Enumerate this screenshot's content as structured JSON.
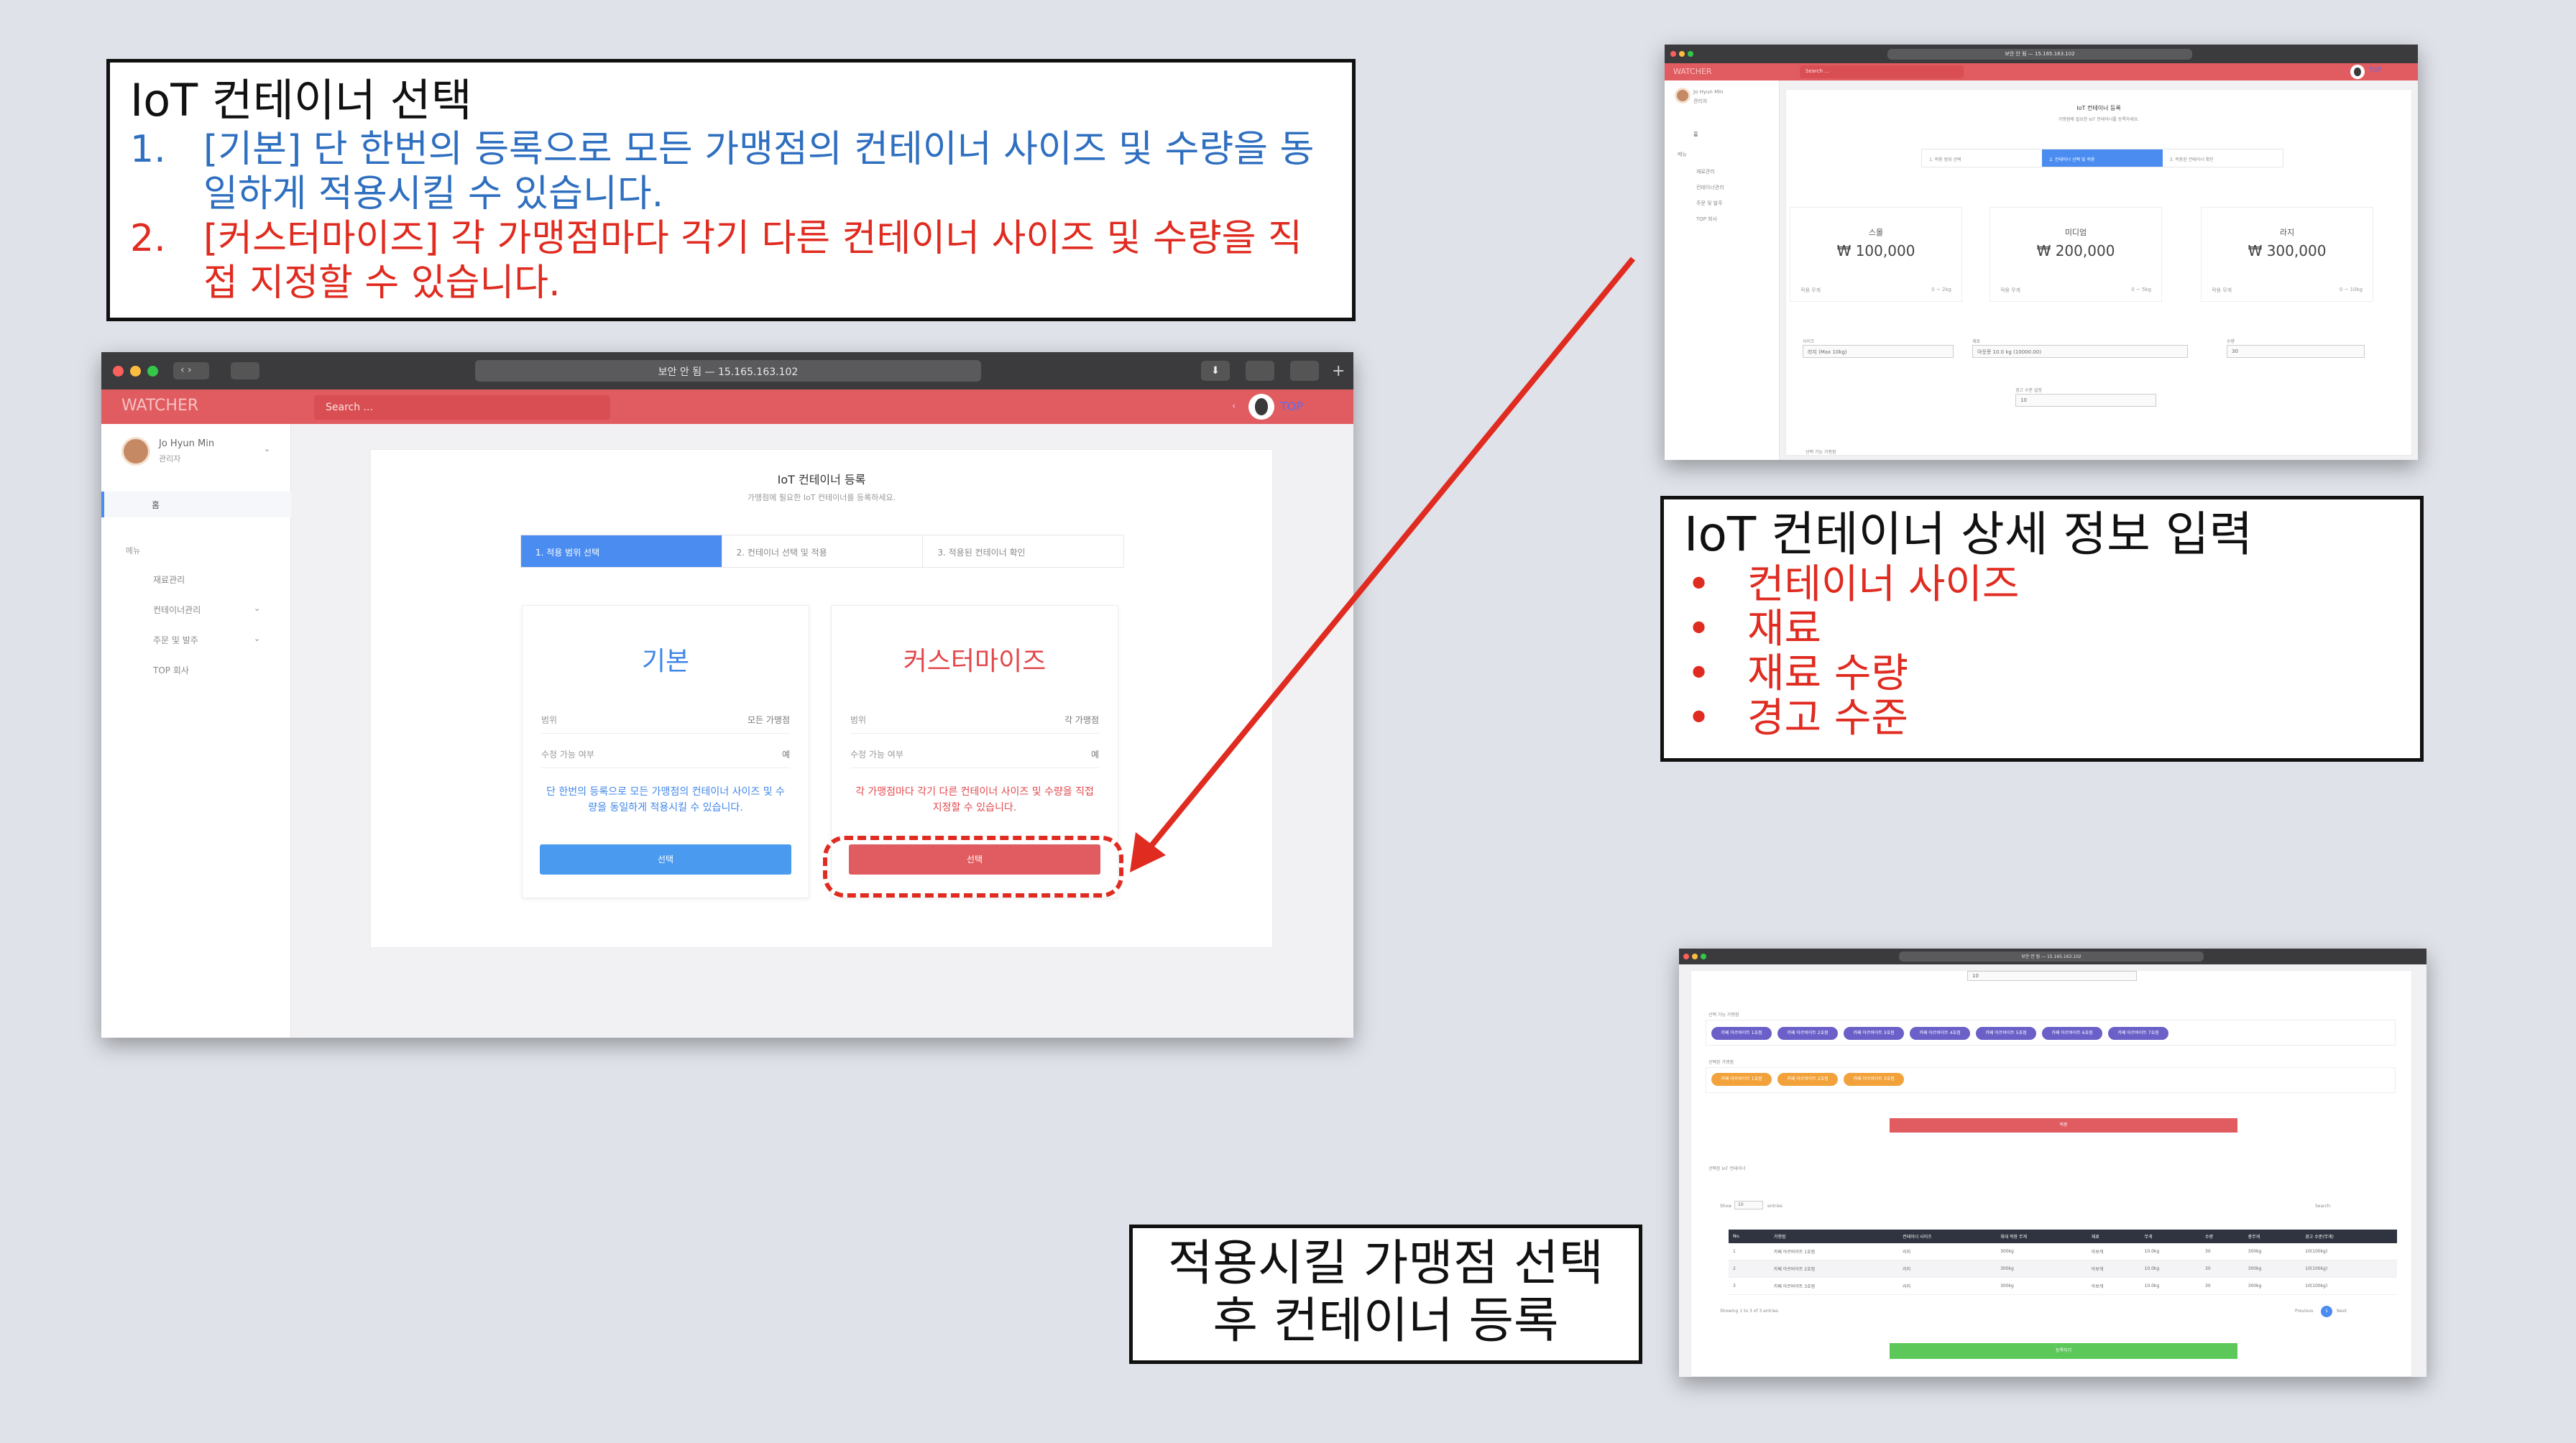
{
  "callout_select": {
    "title": "IoT 컨테이너 선택",
    "items": [
      {
        "num": "1.",
        "text": "[기본] 단 한번의 등록으로 모든 가맹점의 컨테이너 사이즈 및 수량을 동일하게 적용시킬 수 있습니다."
      },
      {
        "num": "2.",
        "text": "[커스터마이즈] 각 가맹점마다 각기 다른 컨테이너 사이즈 및 수량을 직접 지정할 수 있습니다."
      }
    ]
  },
  "callout_detail": {
    "title": "IoT 컨테이너 상세 정보 입력",
    "bullet": "•",
    "items": [
      "컨테이너 사이즈",
      "재료",
      "재료 수량",
      "경고 수준"
    ]
  },
  "callout_apply": {
    "line1": "적용시킬 가맹점 선택",
    "line2": "후 컨테이너 등록"
  },
  "main_window": {
    "url": "보안 안 됨 — 15.165.163.102",
    "brand": "WATCHER",
    "search_placeholder": "Search ...",
    "top_user": "TOP",
    "user_name": "Jo Hyun Min",
    "user_role": "관리자",
    "sidebar": {
      "home": "홈",
      "menu_label": "메뉴",
      "items": [
        "재료관리",
        "컨테이너관리",
        "주문 및 발주",
        "TOP 회사"
      ]
    },
    "page_title": "IoT 컨테이너 등록",
    "page_subtitle": "가맹점에 필요한 IoT 컨테이너를 등록하세요.",
    "steps": [
      "1. 적용 범위 선택",
      "2. 컨테이너 선택 및 적용",
      "3. 적용된 컨테이너 확인"
    ],
    "cards": {
      "basic": {
        "name": "기본",
        "scope_label": "범위",
        "scope_value": "모든 가맹점",
        "editable_label": "수정 가능 여부",
        "editable_value": "예",
        "desc": "단 한번의 등록으로 모든 가맹점의 컨테이너 사이즈 및 수량을 동일하게 적용시킬 수 있습니다.",
        "button": "선택"
      },
      "custom": {
        "name": "커스터마이즈",
        "scope_label": "범위",
        "scope_value": "각 가맹점",
        "editable_label": "수정 가능 여부",
        "editable_value": "예",
        "desc": "각 가맹점마다 각기 다른 컨테이너 사이즈 및 수량을 직접 지정할 수 있습니다.",
        "button": "선택"
      }
    }
  },
  "detail_window": {
    "url": "보안 안 됨 — 15.165.163.102",
    "brand": "WATCHER",
    "search_placeholder": "Search ...",
    "top_user": "TOP",
    "user_name": "Jo Hyun Min",
    "user_role": "관리자",
    "sidebar": {
      "home": "홈",
      "menu_label": "메뉴",
      "items": [
        "재료관리",
        "컨테이너관리",
        "주문 및 발주",
        "TOP 회사"
      ]
    },
    "page_title": "IoT 컨테이너 등록",
    "page_subtitle": "가맹점에 필요한 IoT 컨테이너를 등록하세요.",
    "steps": [
      "1. 적용 범위 선택",
      "2. 컨테이너 선택 및 적용",
      "3. 적용된 컨테이너 확인"
    ],
    "sizes": [
      {
        "name": "스몰",
        "price": "₩ 100,000",
        "left": "적용 무게",
        "right": "0 ~ 2kg"
      },
      {
        "name": "미디엄",
        "price": "₩ 200,000",
        "left": "적용 무게",
        "right": "0 ~ 5kg"
      },
      {
        "name": "라지",
        "price": "₩ 300,000",
        "left": "적용 무게",
        "right": "0 ~ 10kg"
      }
    ],
    "fields": {
      "size_label": "사이즈",
      "size_value": "라지 (Max 10kg)",
      "material_label": "재료",
      "material_value": "아웃풋 10.0 kg (10000.00)",
      "qty_label": "수량",
      "qty_value": "30",
      "warn_label": "경고 수준 설정",
      "warn_value": "10",
      "selectable_label": "선택 가능 가맹점"
    }
  },
  "apply_window": {
    "url": "보안 안 됨 — 15.165.163.102",
    "select_value": "10",
    "available_label": "선택 가능 가맹점",
    "available_pills": [
      "카페 아르바이트 1호점",
      "카페 아르바이트 2호점",
      "카페 아르바이트 3호점",
      "카페 아르바이트 4호점",
      "카페 아르바이트 5호점",
      "카페 아르바이트 6호점",
      "카페 아르바이트 7호점"
    ],
    "selected_label": "선택된 가맹점",
    "selected_pills": [
      "카페 아르바이트 1호점",
      "카페 아르바이트 2호점",
      "카페 아르바이트 3호점"
    ],
    "apply_button": "적용",
    "table_title": "선택된 IoT 컨테이너",
    "show_label": "Show",
    "show_value": "10",
    "entries_label": "entries",
    "search_label": "Search:",
    "columns": [
      "No.",
      "가맹점",
      "컨테이너 사이즈",
      "최대 적용 무게",
      "재료",
      "무게",
      "수량",
      "총무게",
      "경고 수준(무게)"
    ],
    "rows": [
      [
        "1",
        "카페 아르바이트 1호점",
        "라지",
        "300kg",
        "아보캐",
        "10.0kg",
        "30",
        "300kg",
        "10(100kg)"
      ],
      [
        "2",
        "카페 아르바이트 2호점",
        "라지",
        "300kg",
        "아보캐",
        "10.0kg",
        "30",
        "300kg",
        "10(100kg)"
      ],
      [
        "3",
        "카페 아르바이트 3호점",
        "라지",
        "300kg",
        "아보캐",
        "10.0kg",
        "30",
        "300kg",
        "10(100kg)"
      ]
    ],
    "showing": "Showing 1 to 3 of 3 entries",
    "prev": "Previous",
    "page": "1",
    "next": "Next",
    "register_button": "등록하기"
  },
  "colors": {
    "accent_red": "#e05c60",
    "accent_blue": "#4a8cf0",
    "annotation_red": "#e02b20",
    "annotation_blue": "#2f6fc0",
    "success_green": "#5cc85a"
  }
}
